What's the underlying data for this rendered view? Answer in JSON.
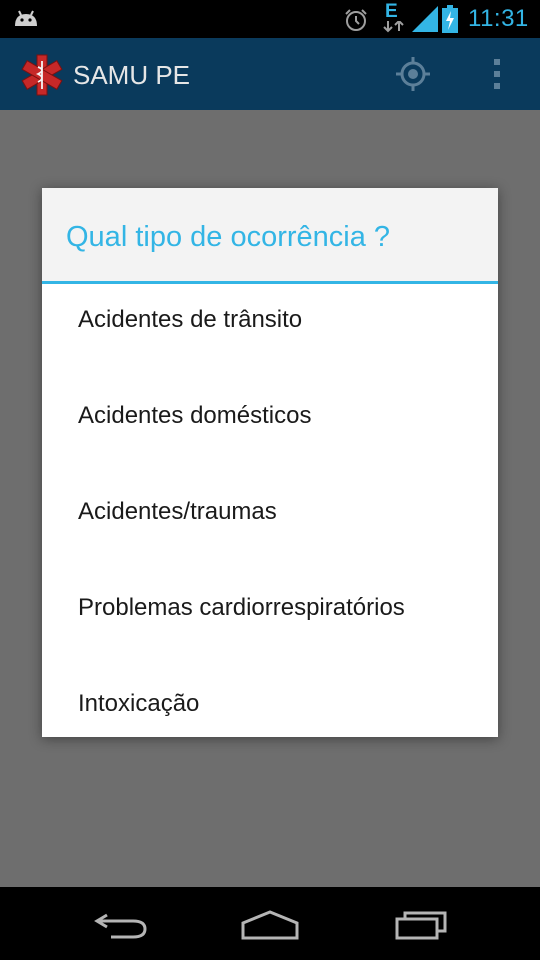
{
  "status_bar": {
    "time": "11:31",
    "network": "E",
    "icons": [
      "android-notification-icon",
      "alarm-icon",
      "edge-data-icon",
      "signal-icon",
      "battery-charging-icon"
    ]
  },
  "action_bar": {
    "title": "SAMU PE",
    "icons": [
      "star-of-life-icon",
      "gps-locate-icon",
      "overflow-menu-icon"
    ]
  },
  "dialog": {
    "title": "Qual tipo de ocorrência ?",
    "options": [
      "Acidentes de trânsito",
      "Acidentes domésticos",
      "Acidentes/traumas",
      "Problemas cardiorrespiratórios",
      "Intoxicação"
    ]
  },
  "nav_bar": {
    "icons": [
      "back-icon",
      "home-icon",
      "recents-icon"
    ]
  },
  "colors": {
    "accent": "#33b5e5",
    "action_bar": "#0a3a5c",
    "logo_red": "#c62828",
    "dim_overlay": "#6e6e6e"
  }
}
